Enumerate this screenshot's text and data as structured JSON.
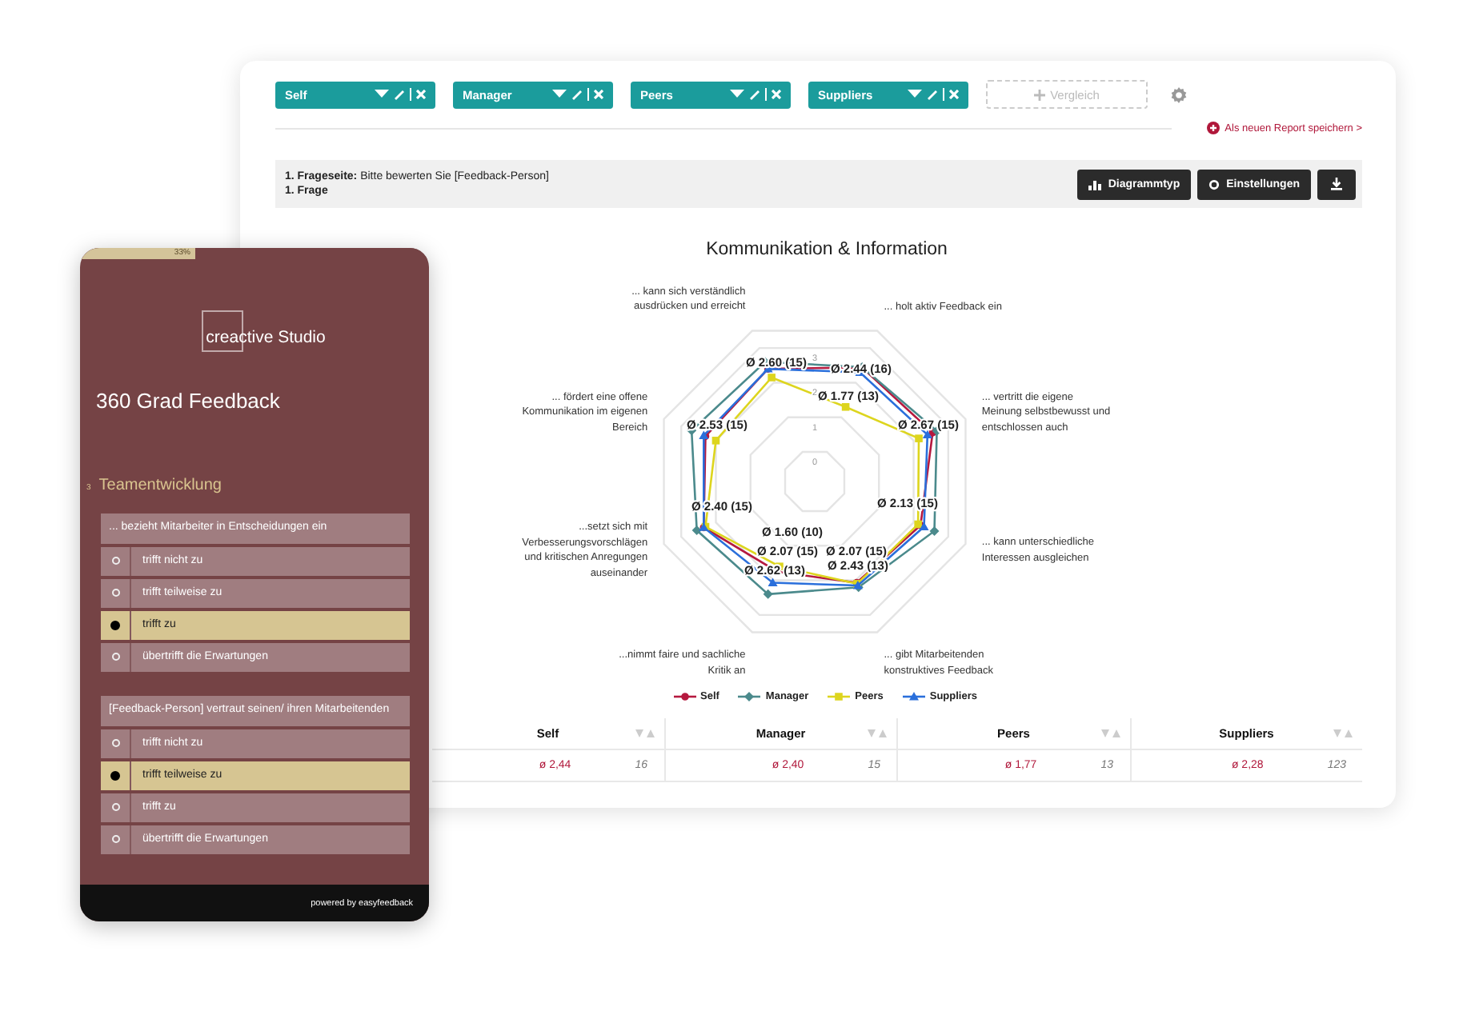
{
  "report": {
    "filters": [
      {
        "label": "Self"
      },
      {
        "label": "Manager"
      },
      {
        "label": "Peers"
      },
      {
        "label": "Suppliers"
      }
    ],
    "compare_button": "Vergleich",
    "save_link": "Als neuen Report speichern >",
    "question_bar": {
      "page_label": "**1. Frageseite:** Bitte bewerten Sie [Feedback-Person]",
      "question": "1. Frage"
    },
    "toolbar_buttons": [
      {
        "kind": "chart",
        "label": "Diagrammtyp"
      },
      {
        "kind": "settings",
        "label": "Einstellungen"
      },
      {
        "kind": "download"
      }
    ],
    "radar_chart": {
      "title": "Kommunikation & Information",
      "ticks": [
        "3",
        "2",
        "1",
        "0"
      ],
      "axes": [
        {
          "label": "... kann sich verständlich ausdrücken und erreicht",
          "value_labels": [
            "Ø 2.60 (15)"
          ]
        },
        {
          "label": "... holt aktiv Feedback ein",
          "value_labels": [
            "Ø 2.44 (16)",
            "Ø 1.77 (13)"
          ]
        },
        {
          "label": "... fördert eine offene Kommunikation im eigenen Bereich",
          "value_labels": [
            "Ø 2.53 (15)"
          ]
        },
        {
          "label": "... vertritt die eigene Meinung selbstbewusst und entschlossen auch",
          "value_labels": [
            "Ø 2.67 (15)"
          ]
        },
        {
          "label": "...setzt sich mit Verbesserungsvorschlägen und kritischen Anregungen auseinander",
          "value_labels": [
            "Ø 2.40 (15)"
          ]
        },
        {
          "label": "... kann unterschiedliche Interessen ausgleichen",
          "value_labels": [
            "Ø 2.13 (15)"
          ]
        },
        {
          "label": "...nimmt faire und sachliche Kritik an",
          "value_labels": [
            "Ø 1.60 (10)",
            "Ø 2.07 (15)",
            "Ø 2.62 (13)"
          ]
        },
        {
          "label": "... gibt Mitarbeitenden konstruktives Feedback",
          "value_labels": [
            "Ø 2.07 (15)",
            "Ø 2.43 (13)"
          ]
        }
      ],
      "series": [
        {
          "name": "Self",
          "color": "#b5193f"
        },
        {
          "name": "Manager",
          "color": "#4b8a8c"
        },
        {
          "name": "Peers",
          "color": "#ddd51e"
        },
        {
          "name": "Suppliers",
          "color": "#2a6fdb"
        }
      ]
    },
    "table": {
      "columns": [
        "Self",
        "Manager",
        "Peers",
        "Suppliers"
      ],
      "rows": [
        {
          "cells": [
            {
              "mean": "ø 2,44",
              "count": "16"
            },
            {
              "mean": "ø 2,40",
              "count": "15"
            },
            {
              "mean": "ø 1,77",
              "count": "13"
            },
            {
              "mean": "ø 2,28",
              "count": "123"
            }
          ]
        }
      ]
    }
  },
  "phone": {
    "progress": {
      "level": 0.33,
      "label": "33%"
    },
    "logo": "creactive Studio",
    "survey_title": "360 Grad Feedback",
    "section": {
      "number": "3",
      "title": "Teamentwicklung"
    },
    "questions": [
      {
        "text": "... bezieht Mitarbeiter in Entscheidungen ein",
        "options": [
          {
            "label": "trifft nicht zu",
            "selected": false
          },
          {
            "label": "trifft teilweise zu",
            "selected": false
          },
          {
            "label": "trifft zu",
            "selected": true
          },
          {
            "label": "übertrifft die Erwartungen",
            "selected": false
          }
        ]
      },
      {
        "text": "[Feedback-Person] vertraut seinen/ ihren Mitarbeitenden",
        "options": [
          {
            "label": "trifft nicht zu",
            "selected": false
          },
          {
            "label": "trifft teilweise zu",
            "selected": true
          },
          {
            "label": "trifft zu",
            "selected": false
          },
          {
            "label": "übertrifft die Erwartungen",
            "selected": false
          }
        ]
      }
    ],
    "footer": "powered by easyfeedback"
  }
}
